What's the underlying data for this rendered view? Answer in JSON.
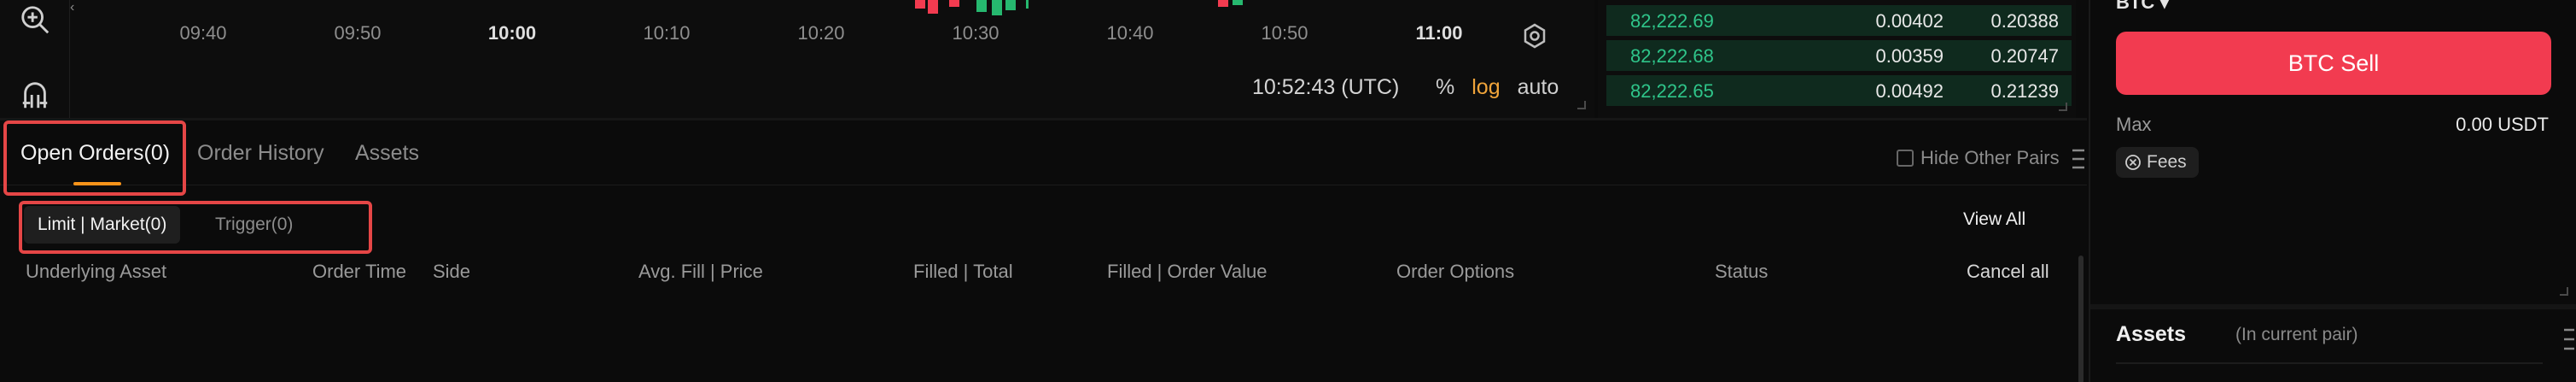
{
  "chart": {
    "time_ticks": [
      {
        "label": "09:40",
        "bold": false
      },
      {
        "label": "09:50",
        "bold": false
      },
      {
        "label": "10:00",
        "bold": true
      },
      {
        "label": "10:10",
        "bold": false
      },
      {
        "label": "10:20",
        "bold": false
      },
      {
        "label": "10:30",
        "bold": false
      },
      {
        "label": "10:40",
        "bold": false
      },
      {
        "label": "10:50",
        "bold": false
      },
      {
        "label": "11:00",
        "bold": true
      }
    ],
    "time_readout": "10:52:43 (UTC)",
    "scale_options": {
      "percent": "%",
      "log": "log",
      "auto": "auto"
    },
    "colors": {
      "up": "#26b86f",
      "down": "#f23b50",
      "log_active": "#f0a43a"
    }
  },
  "orderbook": {
    "rows": [
      {
        "price": "82,222.69",
        "qty": "0.00402",
        "total": "0.20388"
      },
      {
        "price": "82,222.68",
        "qty": "0.00359",
        "total": "0.20747"
      },
      {
        "price": "82,222.65",
        "qty": "0.00492",
        "total": "0.21239"
      }
    ],
    "colors": {
      "bid_price": "#2fc58a",
      "bid_bg": "#0f2a1e"
    }
  },
  "trade_panel": {
    "pair_label": "BTC ▾",
    "sell_button": "BTC Sell",
    "max_label": "Max",
    "max_value": "0.00 USDT",
    "fees_label": "Fees",
    "assets_title": "Assets",
    "assets_sub": "(In current pair)",
    "colors": {
      "sell": "#f23b50"
    }
  },
  "orders": {
    "tabs": [
      {
        "label": "Open Orders(0)",
        "active": true
      },
      {
        "label": "Order History",
        "active": false
      },
      {
        "label": "Assets",
        "active": false
      }
    ],
    "hide_other_pairs": "Hide Other Pairs",
    "subtabs": [
      {
        "label": "Limit | Market(0)",
        "active": true
      },
      {
        "label": "Trigger(0)",
        "active": false
      }
    ],
    "view_all": "View All",
    "columns": [
      "Underlying Asset",
      "Order Time",
      "Side",
      "Avg. Fill | Price",
      "Filled | Total",
      "Filled | Order Value",
      "Order Options",
      "Status",
      "Cancel all"
    ],
    "colors": {
      "accent": "#f7931a",
      "highlight_box": "#e54646"
    }
  }
}
